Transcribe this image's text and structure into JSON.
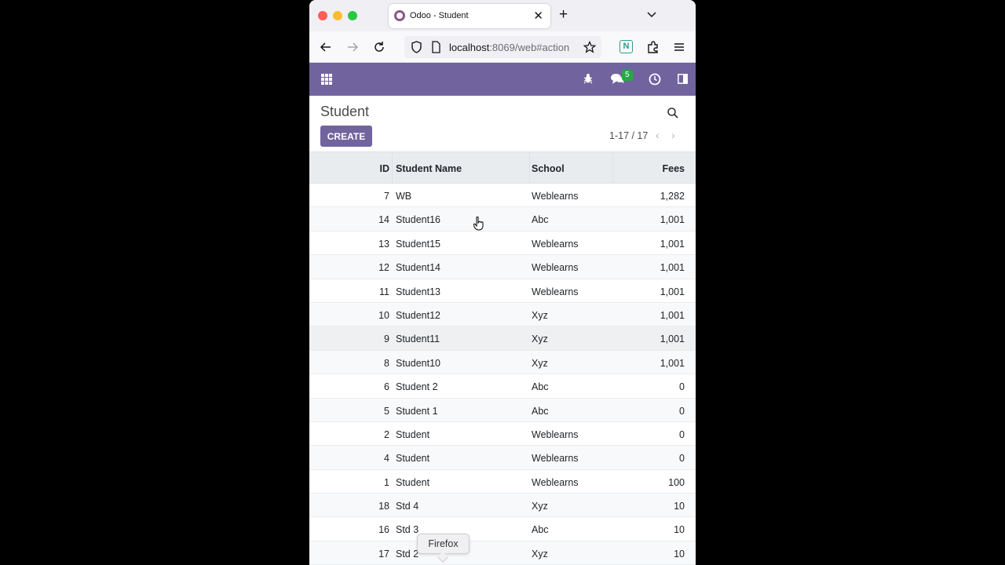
{
  "browser": {
    "tab_title": "Odoo - Student",
    "tab_close": "✕",
    "new_tab": "+",
    "url_host": "localhost",
    "url_rest": ":8069/web#action"
  },
  "odoo": {
    "notification_count": "5",
    "accent_color": "#71639e"
  },
  "control_panel": {
    "title": "Student",
    "create_label": "CREATE",
    "pager": "1-17 / 17",
    "pager_prev": "‹",
    "pager_next": "›"
  },
  "table": {
    "headers": {
      "id": "ID",
      "name": "Student Name",
      "school": "School",
      "fees": "Fees"
    },
    "rows": [
      {
        "id": "7",
        "name": "WB",
        "school": "Weblearns",
        "fees": "1,282"
      },
      {
        "id": "14",
        "name": "Student16",
        "school": "Abc",
        "fees": "1,001"
      },
      {
        "id": "13",
        "name": "Student15",
        "school": "Weblearns",
        "fees": "1,001"
      },
      {
        "id": "12",
        "name": "Student14",
        "school": "Weblearns",
        "fees": "1,001"
      },
      {
        "id": "11",
        "name": "Student13",
        "school": "Weblearns",
        "fees": "1,001"
      },
      {
        "id": "10",
        "name": "Student12",
        "school": "Xyz",
        "fees": "1,001"
      },
      {
        "id": "9",
        "name": "Student11",
        "school": "Xyz",
        "fees": "1,001"
      },
      {
        "id": "8",
        "name": "Student10",
        "school": "Xyz",
        "fees": "1,001"
      },
      {
        "id": "6",
        "name": "Student 2",
        "school": "Abc",
        "fees": "0"
      },
      {
        "id": "5",
        "name": "Student 1",
        "school": "Abc",
        "fees": "0"
      },
      {
        "id": "2",
        "name": "Student",
        "school": "Weblearns",
        "fees": "0"
      },
      {
        "id": "4",
        "name": "Student",
        "school": "Weblearns",
        "fees": "0"
      },
      {
        "id": "1",
        "name": "Student",
        "school": "Weblearns",
        "fees": "100"
      },
      {
        "id": "18",
        "name": "Std 4",
        "school": "Xyz",
        "fees": "10"
      },
      {
        "id": "16",
        "name": "Std 3",
        "school": "Abc",
        "fees": "10"
      },
      {
        "id": "17",
        "name": "Std 2",
        "school": "Xyz",
        "fees": "10"
      }
    ]
  },
  "tooltip": {
    "text": "Firefox"
  }
}
